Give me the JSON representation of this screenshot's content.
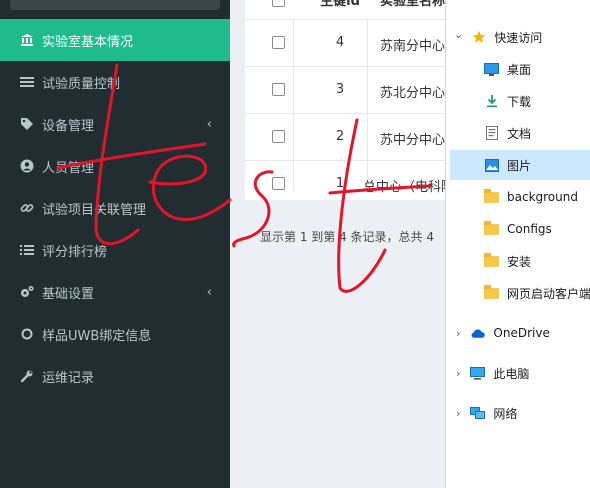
{
  "sidebar": {
    "items": [
      {
        "label": "实验室基本情况",
        "icon": "bank-icon",
        "active": true,
        "caret": false
      },
      {
        "label": "试验质量控制",
        "icon": "list-icon",
        "active": false,
        "caret": false
      },
      {
        "label": "设备管理",
        "icon": "tags-icon",
        "active": false,
        "caret": true
      },
      {
        "label": "人员管理",
        "icon": "user-circle-icon",
        "active": false,
        "caret": false
      },
      {
        "label": "试验项目关联管理",
        "icon": "link-icon",
        "active": false,
        "caret": false
      },
      {
        "label": "评分排行榜",
        "icon": "list-ol-icon",
        "active": false,
        "caret": false
      },
      {
        "label": "基础设置",
        "icon": "cogs-icon",
        "active": false,
        "caret": true
      },
      {
        "label": "样品UWB绑定信息",
        "icon": "circle-icon",
        "active": false,
        "caret": false
      },
      {
        "label": "运维记录",
        "icon": "wrench-icon",
        "active": false,
        "caret": false
      }
    ],
    "caret_glyph": "‹"
  },
  "table": {
    "headers": [
      "主键id",
      "实验室名称"
    ],
    "rows": [
      {
        "id": "4",
        "name": "苏南分中心"
      },
      {
        "id": "3",
        "name": "苏北分中心"
      },
      {
        "id": "2",
        "name": "苏中分中心"
      },
      {
        "id": "1",
        "name": "总中心（电科院"
      }
    ],
    "summary": "显示第 1 到第 4 条记录，总共 4"
  },
  "explorer": {
    "quick_access": "快速访问",
    "pinned": [
      {
        "label": "桌面",
        "icon": "desktop-icon"
      },
      {
        "label": "下载",
        "icon": "download-icon"
      },
      {
        "label": "文档",
        "icon": "document-icon"
      },
      {
        "label": "图片",
        "icon": "picture-icon",
        "selected": true
      },
      {
        "label": "background",
        "icon": "folder-icon"
      },
      {
        "label": "Configs",
        "icon": "folder-icon"
      },
      {
        "label": "安装",
        "icon": "folder-icon"
      },
      {
        "label": "网页启动客户端",
        "icon": "folder-icon"
      }
    ],
    "roots": [
      {
        "label": "OneDrive",
        "icon": "cloud-icon"
      },
      {
        "label": "此电脑",
        "icon": "pc-icon"
      },
      {
        "label": "网络",
        "icon": "network-icon"
      }
    ],
    "chev_open": "⌄",
    "chev_closed": "›"
  },
  "colors": {
    "sidebar_bg": "#222d32",
    "active": "#1ebc8c",
    "scribble": "#e4142a"
  }
}
